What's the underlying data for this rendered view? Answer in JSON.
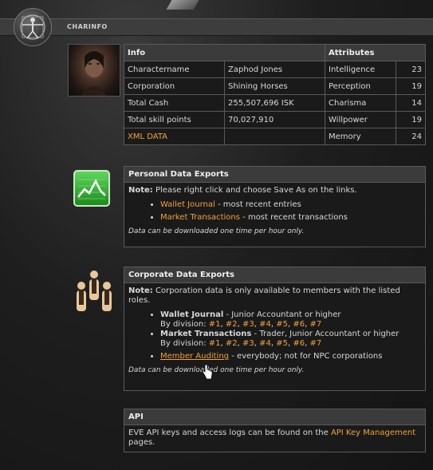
{
  "header": {
    "title": "CHARINFO"
  },
  "info_table": {
    "info_header": "Info",
    "attributes_header": "Attributes",
    "rows": [
      {
        "label": "Charactername",
        "value": "Zaphod Jones",
        "attr": "Intelligence",
        "attr_value": "23"
      },
      {
        "label": "Corporation",
        "value": "Shining Horses",
        "attr": "Perception",
        "attr_value": "19"
      },
      {
        "label": "Total Cash",
        "value": "255,507,696 ISK",
        "attr": "Charisma",
        "attr_value": "14"
      },
      {
        "label": "Total skill points",
        "value": "70,027,910",
        "attr": "Willpower",
        "attr_value": "19"
      },
      {
        "label": "XML DATA",
        "value": "",
        "attr": "Memory",
        "attr_value": "24"
      }
    ]
  },
  "personal": {
    "title": "Personal Data Exports",
    "note_label": "Note:",
    "note_text": "Please right click and choose Save As on the links.",
    "links": [
      {
        "link": "Wallet Journal",
        "text": " - most recent entries"
      },
      {
        "link": "Market Transactions",
        "text": " - most recent transactions"
      }
    ],
    "footer": "Data can be downloaded one time per hour only."
  },
  "corporate": {
    "title": "Corporate Data Exports",
    "note_label": "Note:",
    "note_text": "Corporation data is only available to members with the listed roles.",
    "items": [
      {
        "bold": "Wallet Journal",
        "text": " - Junior Accountant or higher",
        "division_label": "By division:",
        "divisions": [
          "#1",
          "#2",
          "#3",
          "#4",
          "#5",
          "#6",
          "#7"
        ]
      },
      {
        "bold": "Market Transactions",
        "text": " - Trader, Junior Accountant or higher",
        "division_label": "By division:",
        "divisions": [
          "#1",
          "#2",
          "#3",
          "#4",
          "#5",
          "#6",
          "#7"
        ]
      }
    ],
    "audit_link": "Member Auditing",
    "audit_text": " - everybody; not for NPC corporations",
    "footer": "Data can be downloaded one time per hour only."
  },
  "api": {
    "title": "API",
    "text1": "EVE API keys and access logs can be found on the ",
    "link": "API Key Management",
    "text2": " pages."
  }
}
